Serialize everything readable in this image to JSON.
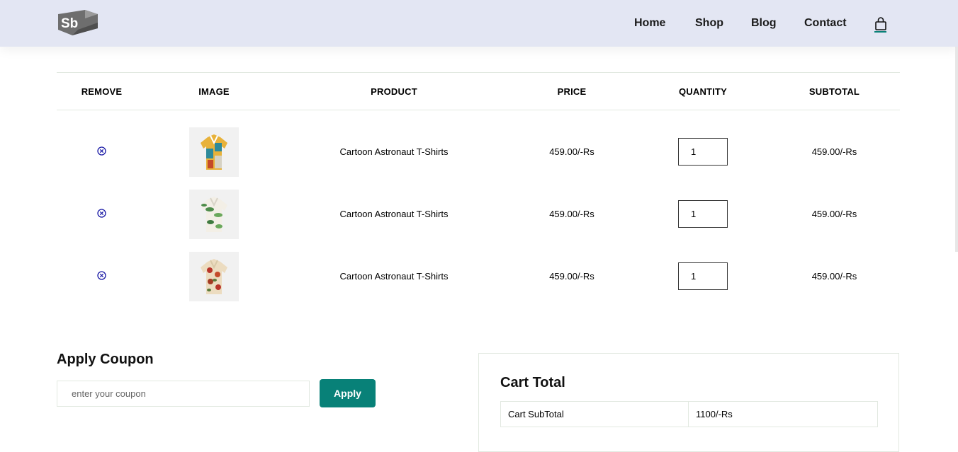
{
  "header": {
    "logo_text": "Sb",
    "nav": [
      {
        "label": "Home"
      },
      {
        "label": "Shop"
      },
      {
        "label": "Blog"
      },
      {
        "label": "Contact"
      }
    ],
    "bag_icon": "shopping-bag-icon"
  },
  "table": {
    "columns": [
      "REMOVE",
      "IMAGE",
      "PRODUCT",
      "PRICE",
      "QUANTITY",
      "SUBTOTAL"
    ],
    "rows": [
      {
        "product": "Cartoon Astronaut T-Shirts",
        "price": "459.00/-Rs",
        "quantity": "1",
        "subtotal": "459.00/-Rs",
        "image": "shirt-yellow-teal-patchwork"
      },
      {
        "product": "Cartoon Astronaut T-Shirts",
        "price": "459.00/-Rs",
        "quantity": "1",
        "subtotal": "459.00/-Rs",
        "image": "shirt-white-green-leaves"
      },
      {
        "product": "Cartoon Astronaut T-Shirts",
        "price": "459.00/-Rs",
        "quantity": "1",
        "subtotal": "459.00/-Rs",
        "image": "shirt-cream-red-floral"
      }
    ]
  },
  "coupon": {
    "title": "Apply Coupon",
    "placeholder": "enter your coupon",
    "button": "Apply"
  },
  "cart_total": {
    "title": "Cart Total",
    "rows": [
      {
        "label": "Cart SubTotal",
        "value": "1100/-Rs"
      }
    ]
  },
  "colors": {
    "header_bg": "#e3e6f3",
    "accent": "#088178",
    "remove_icon": "#1a1aa6"
  }
}
